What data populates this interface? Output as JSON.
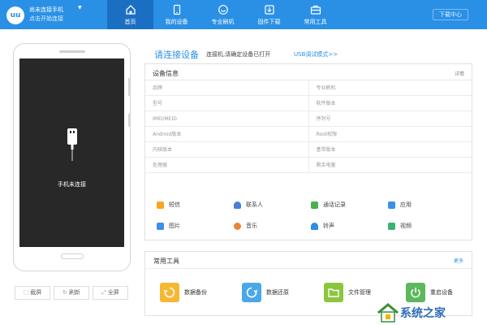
{
  "app": {
    "logo_text": "uu",
    "connect_line1": "尚未连接手机",
    "connect_line2": "点击开始连接",
    "connect_caret": "▼"
  },
  "nav": {
    "items": [
      {
        "label": "首页",
        "icon": "home-icon",
        "active": true
      },
      {
        "label": "我的设备",
        "icon": "device-icon",
        "active": false
      },
      {
        "label": "专业刷机",
        "icon": "flash-icon",
        "active": false
      },
      {
        "label": "固件下载",
        "icon": "download-icon",
        "active": false
      },
      {
        "label": "常用工具",
        "icon": "toolbox-icon",
        "active": false
      }
    ],
    "download_center": "下载中心"
  },
  "phone": {
    "status_text": "手机未连接",
    "buttons": [
      {
        "label": "截屏",
        "icon": "screenshot-icon"
      },
      {
        "label": "刷新",
        "icon": "refresh-icon"
      },
      {
        "label": "全屏",
        "icon": "fullscreen-icon"
      }
    ]
  },
  "header": {
    "title": "请连接设备",
    "desc": "连接机,请确定设备已打开",
    "usb_link": "USB调试模式>>"
  },
  "device_info": {
    "title": "设备信息",
    "detail": "详情",
    "rows": [
      [
        "品牌",
        "专业刷机"
      ],
      [
        "型号",
        "软件版本"
      ],
      [
        "IMEI/MEID",
        "序列号"
      ],
      [
        "Android版本",
        "Root权限"
      ],
      [
        "内核版本",
        "基带版本"
      ],
      [
        "处理器",
        "剩余电量"
      ]
    ],
    "quick": [
      {
        "label": "短信",
        "icon": "sms-icon",
        "color": "#f5a623"
      },
      {
        "label": "联系人",
        "icon": "contacts-icon",
        "color": "#4a7fd6"
      },
      {
        "label": "通话记录",
        "icon": "call-log-icon",
        "color": "#4caf50"
      },
      {
        "label": "应用",
        "icon": "apps-icon",
        "color": "#3a8fe8"
      },
      {
        "label": "图片",
        "icon": "picture-icon",
        "color": "#3a8fe8"
      },
      {
        "label": "音乐",
        "icon": "music-icon",
        "color": "#e8873a"
      },
      {
        "label": "铃声",
        "icon": "ringtone-icon",
        "color": "#2a90e6"
      },
      {
        "label": "视频",
        "icon": "video-icon",
        "color": "#3cb371"
      }
    ]
  },
  "tools": {
    "title": "常用工具",
    "more": "更多",
    "items": [
      {
        "label": "数据备份",
        "icon": "backup-icon",
        "color": "#f7b733"
      },
      {
        "label": "数据还原",
        "icon": "restore-icon",
        "color": "#4aa8e8"
      },
      {
        "label": "文件管理",
        "icon": "folder-icon",
        "color": "#8cc63f"
      },
      {
        "label": "重启设备",
        "icon": "power-icon",
        "color": "#5cb85c"
      }
    ]
  },
  "watermark": {
    "text": "系统之家"
  },
  "colors": {
    "accent": "#2a90e6",
    "nav_active": "#1b6fc2"
  }
}
